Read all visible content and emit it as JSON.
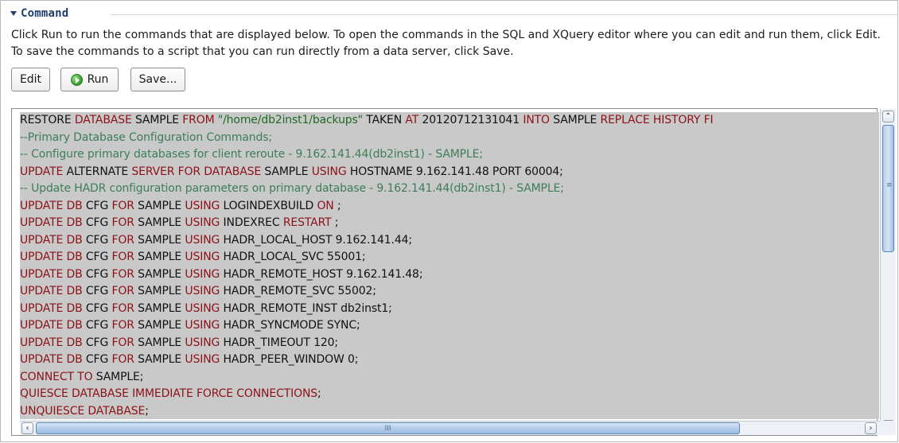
{
  "section": {
    "title": "Command",
    "description": "Click Run to run the commands that are displayed below. To open the commands in the SQL and XQuery editor where you can edit and run them, click Edit. To save the commands to a script that you can run directly from a data server, click Save."
  },
  "buttons": {
    "edit": "Edit",
    "run": "Run",
    "save": "Save..."
  },
  "colors": {
    "keyword": "#8c1218",
    "string": "#1f6a25",
    "comment": "#3c7e58",
    "editor_background": "#c9c9c9"
  },
  "code_lines": [
    [
      {
        "t": "RESTORE ",
        "c": "plain"
      },
      {
        "t": "DATABASE",
        "c": "kw"
      },
      {
        "t": " SAMPLE ",
        "c": "plain"
      },
      {
        "t": "FROM",
        "c": "kw"
      },
      {
        "t": " ",
        "c": "plain"
      },
      {
        "t": "\"/home/db2inst1/backups\"",
        "c": "str"
      },
      {
        "t": " TAKEN ",
        "c": "plain"
      },
      {
        "t": "AT",
        "c": "kw"
      },
      {
        "t": " 20120712131041 ",
        "c": "plain"
      },
      {
        "t": "INTO",
        "c": "kw"
      },
      {
        "t": " SAMPLE ",
        "c": "plain"
      },
      {
        "t": "REPLACE HISTORY FI",
        "c": "kw"
      }
    ],
    [
      {
        "t": "--Primary Database Configuration Commands;",
        "c": "comment"
      }
    ],
    [
      {
        "t": "-- Configure primary databases for client reroute - 9.162.141.44(db2inst1) - SAMPLE;",
        "c": "comment"
      }
    ],
    [
      {
        "t": "UPDATE",
        "c": "kw"
      },
      {
        "t": " ALTERNATE ",
        "c": "plain"
      },
      {
        "t": "SERVER FOR DATABASE",
        "c": "kw"
      },
      {
        "t": " SAMPLE ",
        "c": "plain"
      },
      {
        "t": "USING",
        "c": "kw"
      },
      {
        "t": " HOSTNAME 9.162.141.48 PORT 60004;",
        "c": "plain"
      }
    ],
    [
      {
        "t": "-- Update HADR configuration parameters on primary database - 9.162.141.44(db2inst1) - SAMPLE;",
        "c": "comment"
      }
    ],
    [
      {
        "t": "UPDATE DB",
        "c": "kw"
      },
      {
        "t": " CFG ",
        "c": "plain"
      },
      {
        "t": "FOR",
        "c": "kw"
      },
      {
        "t": " SAMPLE ",
        "c": "plain"
      },
      {
        "t": "USING",
        "c": "kw"
      },
      {
        "t": " LOGINDEXBUILD ",
        "c": "plain"
      },
      {
        "t": "ON",
        "c": "kw"
      },
      {
        "t": " ;",
        "c": "plain"
      }
    ],
    [
      {
        "t": "UPDATE DB",
        "c": "kw"
      },
      {
        "t": " CFG ",
        "c": "plain"
      },
      {
        "t": "FOR",
        "c": "kw"
      },
      {
        "t": " SAMPLE ",
        "c": "plain"
      },
      {
        "t": "USING",
        "c": "kw"
      },
      {
        "t": " INDEXREC ",
        "c": "plain"
      },
      {
        "t": "RESTART",
        "c": "kw"
      },
      {
        "t": " ;",
        "c": "plain"
      }
    ],
    [
      {
        "t": "UPDATE DB",
        "c": "kw"
      },
      {
        "t": " CFG ",
        "c": "plain"
      },
      {
        "t": "FOR",
        "c": "kw"
      },
      {
        "t": " SAMPLE ",
        "c": "plain"
      },
      {
        "t": "USING",
        "c": "kw"
      },
      {
        "t": " HADR_LOCAL_HOST 9.162.141.44;",
        "c": "plain"
      }
    ],
    [
      {
        "t": "UPDATE DB",
        "c": "kw"
      },
      {
        "t": " CFG ",
        "c": "plain"
      },
      {
        "t": "FOR",
        "c": "kw"
      },
      {
        "t": " SAMPLE ",
        "c": "plain"
      },
      {
        "t": "USING",
        "c": "kw"
      },
      {
        "t": " HADR_LOCAL_SVC 55001;",
        "c": "plain"
      }
    ],
    [
      {
        "t": "UPDATE DB",
        "c": "kw"
      },
      {
        "t": " CFG ",
        "c": "plain"
      },
      {
        "t": "FOR",
        "c": "kw"
      },
      {
        "t": " SAMPLE ",
        "c": "plain"
      },
      {
        "t": "USING",
        "c": "kw"
      },
      {
        "t": " HADR_REMOTE_HOST 9.162.141.48;",
        "c": "plain"
      }
    ],
    [
      {
        "t": "UPDATE DB",
        "c": "kw"
      },
      {
        "t": " CFG ",
        "c": "plain"
      },
      {
        "t": "FOR",
        "c": "kw"
      },
      {
        "t": " SAMPLE ",
        "c": "plain"
      },
      {
        "t": "USING",
        "c": "kw"
      },
      {
        "t": " HADR_REMOTE_SVC 55002;",
        "c": "plain"
      }
    ],
    [
      {
        "t": "UPDATE DB",
        "c": "kw"
      },
      {
        "t": " CFG ",
        "c": "plain"
      },
      {
        "t": "FOR",
        "c": "kw"
      },
      {
        "t": " SAMPLE ",
        "c": "plain"
      },
      {
        "t": "USING",
        "c": "kw"
      },
      {
        "t": " HADR_REMOTE_INST db2inst1;",
        "c": "plain"
      }
    ],
    [
      {
        "t": "UPDATE DB",
        "c": "kw"
      },
      {
        "t": " CFG ",
        "c": "plain"
      },
      {
        "t": "FOR",
        "c": "kw"
      },
      {
        "t": " SAMPLE ",
        "c": "plain"
      },
      {
        "t": "USING",
        "c": "kw"
      },
      {
        "t": " HADR_SYNCMODE SYNC;",
        "c": "plain"
      }
    ],
    [
      {
        "t": "UPDATE DB",
        "c": "kw"
      },
      {
        "t": " CFG ",
        "c": "plain"
      },
      {
        "t": "FOR",
        "c": "kw"
      },
      {
        "t": " SAMPLE ",
        "c": "plain"
      },
      {
        "t": "USING",
        "c": "kw"
      },
      {
        "t": " HADR_TIMEOUT 120;",
        "c": "plain"
      }
    ],
    [
      {
        "t": "UPDATE DB",
        "c": "kw"
      },
      {
        "t": " CFG ",
        "c": "plain"
      },
      {
        "t": "FOR",
        "c": "kw"
      },
      {
        "t": " SAMPLE ",
        "c": "plain"
      },
      {
        "t": "USING",
        "c": "kw"
      },
      {
        "t": " HADR_PEER_WINDOW 0;",
        "c": "plain"
      }
    ],
    [
      {
        "t": "CONNECT TO",
        "c": "kw"
      },
      {
        "t": " SAMPLE;",
        "c": "plain"
      }
    ],
    [
      {
        "t": "QUIESCE DATABASE IMMEDIATE FORCE CONNECTIONS",
        "c": "kw"
      },
      {
        "t": ";",
        "c": "plain"
      }
    ],
    [
      {
        "t": "UNQUIESCE DATABASE",
        "c": "kw"
      },
      {
        "t": ";",
        "c": "plain"
      }
    ]
  ],
  "scrollbars": {
    "vertical_grip": "≡",
    "horizontal_grip": "III",
    "up_arrow": "⌃",
    "down_arrow": "⌄",
    "left_arrow": "‹",
    "right_arrow": "›"
  }
}
